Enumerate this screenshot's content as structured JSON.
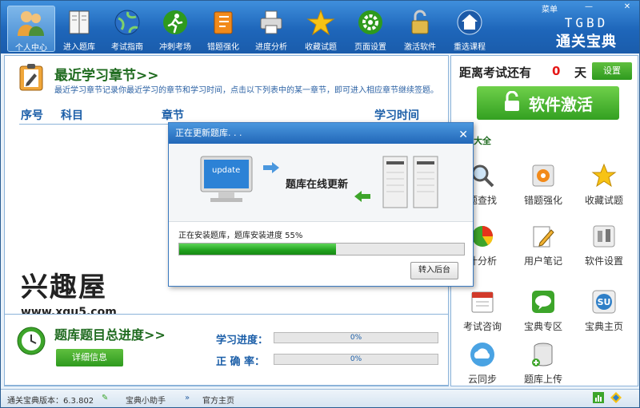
{
  "toolbar": {
    "items": [
      {
        "label": "个人中心",
        "icon": "users-icon"
      },
      {
        "label": "进入题库",
        "icon": "book-icon"
      },
      {
        "label": "考试指南",
        "icon": "globe-icon"
      },
      {
        "label": "冲刺考场",
        "icon": "runner-icon"
      },
      {
        "label": "错题强化",
        "icon": "notebook-icon"
      },
      {
        "label": "进度分析",
        "icon": "printer-icon"
      },
      {
        "label": "收藏试题",
        "icon": "star-icon"
      },
      {
        "label": "页面设置",
        "icon": "gear-icon"
      },
      {
        "label": "激活软件",
        "icon": "lock-icon"
      },
      {
        "label": "重选课程",
        "icon": "home-icon"
      }
    ],
    "menu_label": "菜单",
    "window_min": "—",
    "window_close": "✕"
  },
  "brand": {
    "en": "TGBD",
    "cn": "通关宝典"
  },
  "recent": {
    "title": "最近学习章节>>",
    "description": "最近学习章节记录你最近学习的章节和学习时间，点击以下列表中的某一章节，即可进入相应章节继续签题。",
    "columns": [
      "序号",
      "科目",
      "章节",
      "学习时间"
    ]
  },
  "watermark": {
    "text": "兴趣屋",
    "url": "www.xqu5.com"
  },
  "progress": {
    "title": "题库题目总进度>>",
    "detail_button": "详细信息",
    "study_label": "学习进度：",
    "study_value": "0%",
    "accuracy_label": "正 确 率：",
    "accuracy_value": "0%"
  },
  "exam": {
    "countdown_label": "距离考试还有",
    "days": "0",
    "days_unit": "天",
    "settings_button": "设置",
    "activate_button": "软件激活",
    "tools_title": "大全"
  },
  "tools": [
    {
      "label": "题查找",
      "icon": "magnifier-icon"
    },
    {
      "label": "错题强化",
      "icon": "target-icon"
    },
    {
      "label": "收藏试题",
      "icon": "star-icon"
    },
    {
      "label": "计分析",
      "icon": "pie-chart-icon"
    },
    {
      "label": "用户笔记",
      "icon": "pencil-icon"
    },
    {
      "label": "软件设置",
      "icon": "settings-icon"
    },
    {
      "label": "考试咨询",
      "icon": "calendar-icon"
    },
    {
      "label": "宝典专区",
      "icon": "chat-icon"
    },
    {
      "label": "宝典主页",
      "icon": "stumble-icon"
    },
    {
      "label": "云同步",
      "icon": "cloud-icon"
    },
    {
      "label": "题库上传",
      "icon": "database-icon"
    }
  ],
  "statusbar": {
    "version": "通关宝典版本：6.3.802",
    "assistant": "宝典小助手",
    "homepage": "官方主页"
  },
  "dialog": {
    "title": "正在更新题库. . .",
    "close": "✕",
    "screen_label": "update",
    "headline": "题库在线更新",
    "status": "正在安装题库，题库安装进度 55%",
    "progress": 0.55,
    "background_button": "转入后台"
  }
}
